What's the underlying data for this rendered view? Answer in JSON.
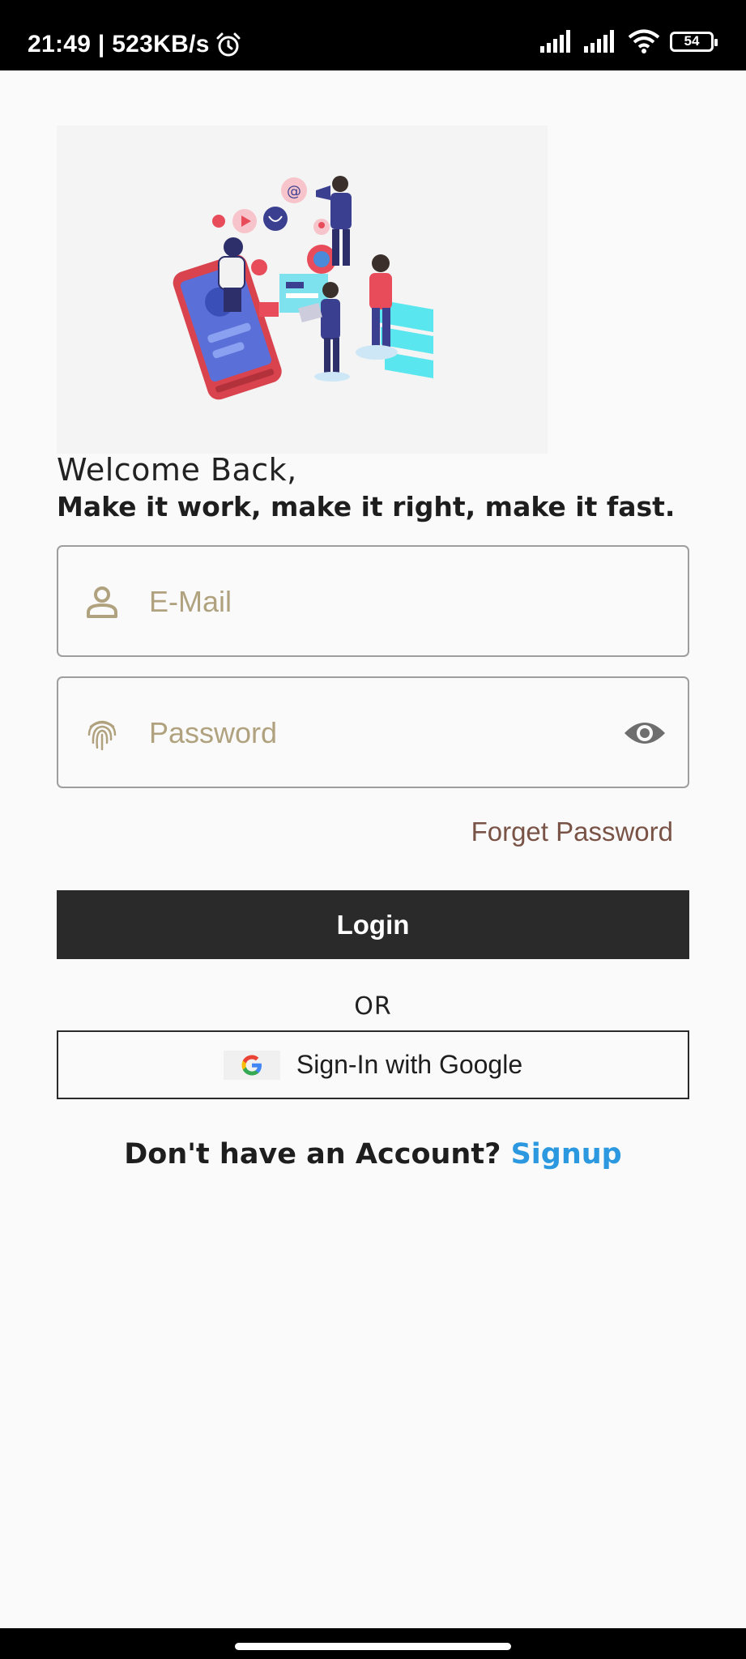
{
  "status_bar": {
    "time_speed": "21:49 | 523KB/s",
    "battery": "54",
    "icons": [
      "alarm-icon",
      "signal-icon",
      "signal-icon",
      "wifi-icon",
      "battery-icon"
    ]
  },
  "illustration": {
    "icon": "social-media-illustration"
  },
  "welcome": {
    "greeting": "Welcome Back,",
    "tagline": "Make it work, make it right, make it fast."
  },
  "form": {
    "email": {
      "placeholder": "E-Mail",
      "value": "",
      "icon": "person-icon"
    },
    "password": {
      "placeholder": "Password",
      "value": "",
      "icon": "fingerprint-icon",
      "toggle_icon": "eye-icon"
    },
    "forget_password": "Forget Password",
    "login_label": "Login",
    "or_label": "OR",
    "google_label": "Sign-In with Google"
  },
  "footer": {
    "prompt": "Don't have an Account?",
    "signup_label": "Signup"
  },
  "colors": {
    "primary_button": "#2a2a2a",
    "placeholder": "#b0a27e",
    "forget_link": "#7a5347",
    "signup_link": "#2b98e0"
  }
}
